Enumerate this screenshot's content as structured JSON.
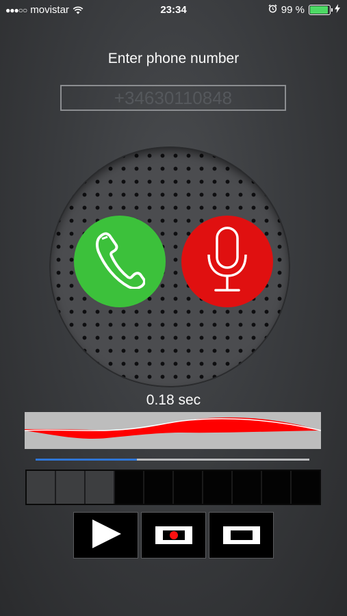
{
  "status_bar": {
    "signal": "●●●○○",
    "carrier": "movistar",
    "time": "23:34",
    "battery_text": "99 %",
    "battery_level": 0.99,
    "icons": [
      "wifi-icon",
      "alarm-icon",
      "battery-icon",
      "charging-bolt-icon"
    ]
  },
  "prompt": "Enter phone number",
  "phone_input": {
    "placeholder": "+34630110848",
    "value": ""
  },
  "buttons": {
    "call_icon": "phone-handset-icon",
    "record_icon": "microphone-icon",
    "call_color": "#3cc13b",
    "record_color": "#e01010"
  },
  "duration": "0.18 sec",
  "waveform": {
    "color": "#ff0000",
    "background": "#bdbdbd"
  },
  "playback": {
    "progress": 0.37,
    "color": "#2f76d6"
  },
  "level_meter": {
    "segments": 10,
    "lit": 3
  },
  "controls": [
    {
      "name": "play",
      "icon": "play-icon"
    },
    {
      "name": "record",
      "icon": "record-icon"
    },
    {
      "name": "stop",
      "icon": "stop-icon"
    }
  ]
}
